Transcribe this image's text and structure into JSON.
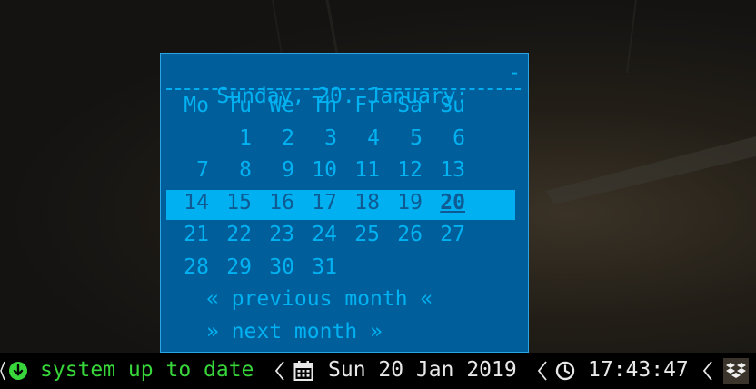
{
  "calendar": {
    "header": "Sunday, 20. January:",
    "collapse": "-",
    "weekdays": [
      "Mo",
      "Tu",
      "We",
      "Th",
      "Fr",
      "Sa",
      "Su"
    ],
    "weeks": [
      [
        "",
        "1",
        "2",
        "3",
        "4",
        "5",
        "6"
      ],
      [
        "7",
        "8",
        "9",
        "10",
        "11",
        "12",
        "13"
      ],
      [
        "14",
        "15",
        "16",
        "17",
        "18",
        "19",
        "20"
      ],
      [
        "21",
        "22",
        "23",
        "24",
        "25",
        "26",
        "27"
      ],
      [
        "28",
        "29",
        "30",
        "31",
        "",
        "",
        ""
      ]
    ],
    "prev": "« previous month «",
    "next": "» next month »"
  },
  "statusbar": {
    "updates": "system up to date",
    "date": "Sun 20 Jan 2019",
    "time": "17:43:47"
  },
  "colors": {
    "popup_bg": "#005f9a",
    "popup_fg": "#00b2f2",
    "highlight": "#00b0f0",
    "status_ok": "#38d63a"
  }
}
